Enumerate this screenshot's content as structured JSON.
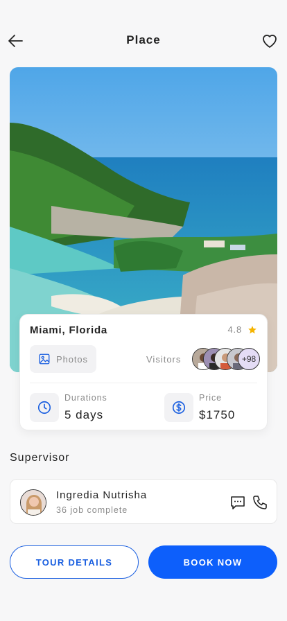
{
  "header": {
    "title": "Place",
    "back_icon": "arrow-left-icon",
    "favorite_icon": "heart-outline-icon"
  },
  "place": {
    "location": "Miami, Florida",
    "rating": "4.8",
    "photos_label": "Photos",
    "visitors_label": "Visitors",
    "visitors_more": "+98",
    "durations_label": "Durations",
    "durations_value": "5 days",
    "price_label": "Price",
    "price_value": "$1750"
  },
  "supervisor": {
    "section_title": "Supervisor",
    "name": "Ingredia Nutrisha",
    "jobs": "36 job complete"
  },
  "actions": {
    "tour_details": "TOUR DETAILS",
    "book_now": "BOOK NOW"
  },
  "colors": {
    "accent": "#0d5ffb",
    "star": "#f5b400",
    "muted": "#8a8a8a"
  }
}
